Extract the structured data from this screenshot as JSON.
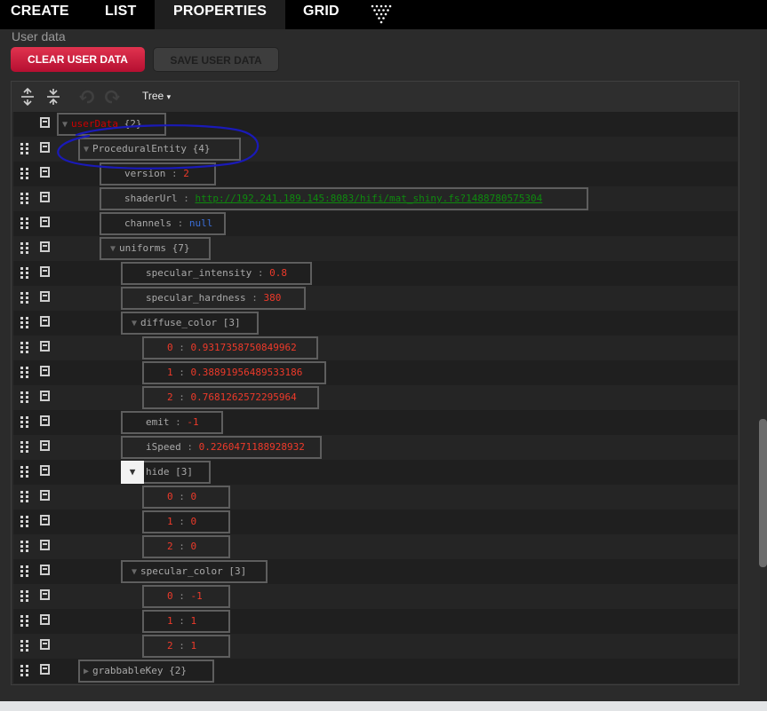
{
  "tabs": [
    {
      "label": "CREATE",
      "active": false
    },
    {
      "label": "LIST",
      "active": false
    },
    {
      "label": "PROPERTIES",
      "active": true
    },
    {
      "label": "GRID",
      "active": false
    }
  ],
  "tab_logo_icon": "dots-logo-icon",
  "section": {
    "label": "User data"
  },
  "buttons": {
    "clear": "CLEAR USER DATA",
    "save": "SAVE USER DATA"
  },
  "toolbar": {
    "icons": [
      "expand-all-icon",
      "collapse-all-icon",
      "undo-icon",
      "redo-icon"
    ],
    "mode_label": "Tree",
    "mode_caret": "▾"
  },
  "tree": {
    "root": {
      "key": "userData",
      "count": "{2}"
    },
    "procedural": {
      "key": "ProceduralEntity",
      "count": "{4}"
    },
    "version": {
      "key": "version",
      "value": "2"
    },
    "shaderUrl": {
      "key": "shaderUrl",
      "value": "http://192.241.189.145:8083/hifi/mat_shiny.fs?1488780575304"
    },
    "channels": {
      "key": "channels",
      "value": "null"
    },
    "uniforms": {
      "key": "uniforms",
      "count": "{7}"
    },
    "specular_intensity": {
      "key": "specular_intensity",
      "value": "0.8"
    },
    "specular_hardness": {
      "key": "specular_hardness",
      "value": "380"
    },
    "diffuse_color": {
      "key": "diffuse_color",
      "count": "[3]",
      "items": [
        {
          "idx": "0",
          "value": "0.9317358750849962"
        },
        {
          "idx": "1",
          "value": "0.38891956489533186"
        },
        {
          "idx": "2",
          "value": "0.7681262572295964"
        }
      ]
    },
    "emit": {
      "key": "emit",
      "value": "-1"
    },
    "iSpeed": {
      "key": "iSpeed",
      "value": "0.2260471188928932"
    },
    "hide": {
      "key": "hide",
      "count": "[3]",
      "items": [
        {
          "idx": "0",
          "value": "0"
        },
        {
          "idx": "1",
          "value": "0"
        },
        {
          "idx": "2",
          "value": "0"
        }
      ]
    },
    "specular_color": {
      "key": "specular_color",
      "count": "[3]",
      "items": [
        {
          "idx": "0",
          "value": "-1"
        },
        {
          "idx": "1",
          "value": "1"
        },
        {
          "idx": "2",
          "value": "1"
        }
      ]
    },
    "grabbableKey": {
      "key": "grabbableKey",
      "count": "{2}"
    },
    "separator": ":"
  },
  "colors": {
    "accent_red": "#c8103a",
    "string_green": "#0e8a0e",
    "number_red": "#ee3a2a",
    "null_blue": "#3b6fd9",
    "annotation_blue": "#1a1ab8"
  }
}
